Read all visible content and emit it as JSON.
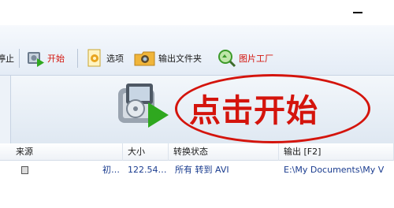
{
  "toolbar": {
    "stop_label": "停止",
    "start_label": "开始",
    "options_label": "选项",
    "output_folder_label": "输出文件夹",
    "image_factory_label": "图片工厂"
  },
  "banner": {
    "start_text": "点击开始"
  },
  "table": {
    "headers": [
      "来源",
      "大小",
      "转换状态",
      "输出 [F2]"
    ],
    "rows": [
      {
        "source": "初…",
        "size": "122.54…",
        "status": "所有 转到 AVI",
        "output": "E:\\My Documents\\My V"
      }
    ]
  },
  "colors": {
    "accent_red": "#d4140c",
    "toolbar_bg": "#e8eef6",
    "link_blue": "#1a3c8f"
  }
}
